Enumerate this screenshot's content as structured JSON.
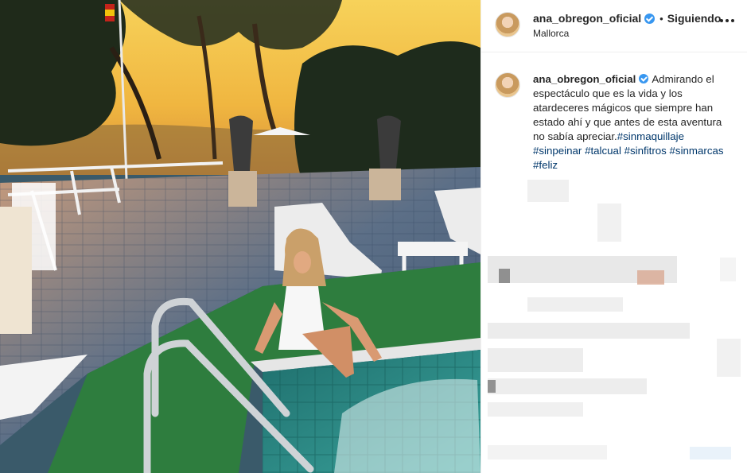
{
  "post": {
    "username": "ana_obregon_oficial",
    "follow_label": "Siguiendo",
    "separator": "•",
    "location": "Mallorca"
  },
  "caption": {
    "username": "ana_obregon_oficial",
    "text": "Admirando el espectáculo que es la vida y los atardeceres mágicos que siempre han estado ahí y que antes de esta aventura no sabía apreciar.",
    "hashtags": [
      "#sinmaquillaje",
      "#sinpeinar",
      "#talcual",
      "#sinfitros",
      "#sinmarcas",
      "#feliz"
    ]
  },
  "icons": {
    "verified": "verified-badge-icon",
    "more": "more-options-icon"
  },
  "colors": {
    "verified": "#3897f0",
    "hashtag": "#00376b",
    "sky": "#f3c24a",
    "pool_grass": "#2e7d3e",
    "pool_water": "#2c8c86"
  }
}
